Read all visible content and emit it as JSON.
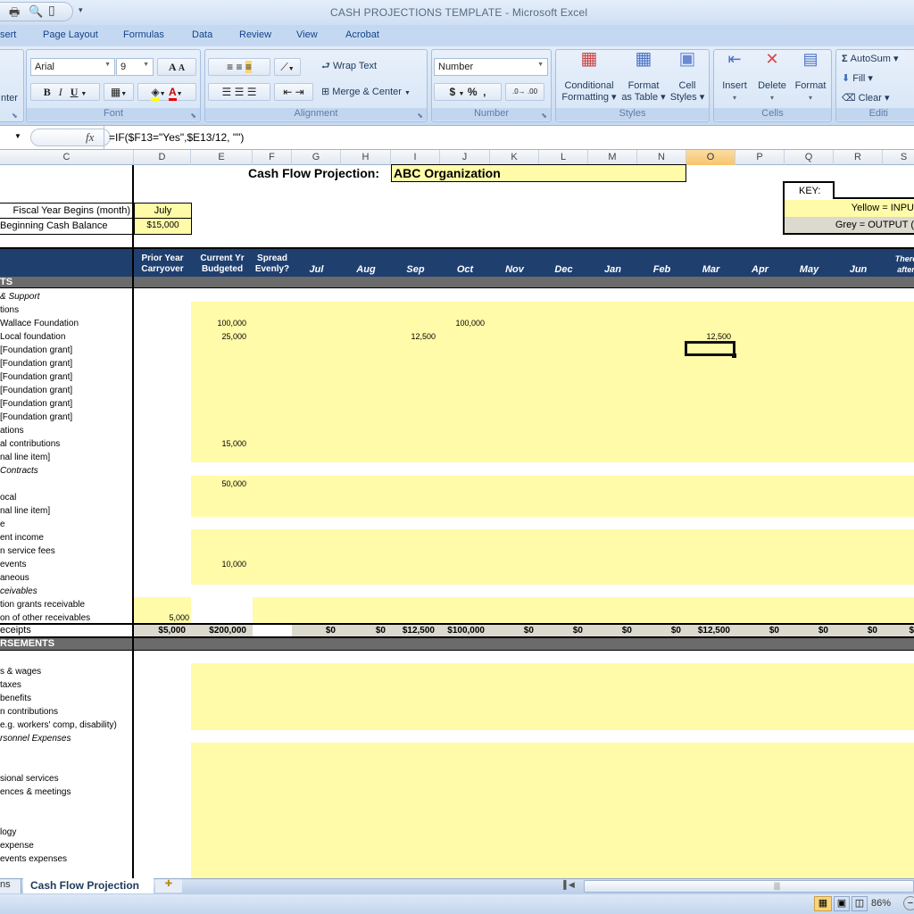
{
  "window": {
    "title": "CASH PROJECTIONS TEMPLATE - Microsoft Excel"
  },
  "quick_access": {
    "icons": [
      "print-icon",
      "print-preview-icon",
      "new-document-icon",
      "customize-dropdown-icon"
    ],
    "dropdown": "▾"
  },
  "ribbon_tabs": [
    "sert",
    "Page Layout",
    "Formulas",
    "Data",
    "Review",
    "View",
    "Acrobat"
  ],
  "ribbon": {
    "clipboard_partial": "nter",
    "font": {
      "name": "Arial",
      "size": "9",
      "label": "Font",
      "bold": "B",
      "italic": "I",
      "underline": "U",
      "grow": "A",
      "shrink": "A",
      "fontcolor": "A"
    },
    "alignment": {
      "label": "Alignment",
      "wrap_text": "Wrap Text",
      "merge_center": "Merge & Center"
    },
    "number": {
      "format": "Number",
      "label": "Number",
      "currency": "$",
      "percent": "%",
      "comma": ",",
      "inc_decimal": "←.0 .00",
      "dec_decimal": ".00 →.0"
    },
    "styles": {
      "label": "Styles",
      "conditional": [
        "Conditional",
        "Formatting"
      ],
      "format_table": [
        "Format",
        "as Table"
      ],
      "cell_styles": [
        "Cell",
        "Styles"
      ]
    },
    "cells": {
      "label": "Cells",
      "insert": "Insert",
      "delete": "Delete",
      "format": "Format"
    },
    "editing": {
      "label": "Editi",
      "autosum": "AutoSum",
      "fill": "Fill",
      "clear": "Clear"
    }
  },
  "formula_bar": {
    "fx": "fx",
    "formula": "=IF($F13=\"Yes\",$E13/12, \"\")"
  },
  "columns": [
    "C",
    "D",
    "E",
    "F",
    "G",
    "H",
    "I",
    "J",
    "K",
    "L",
    "M",
    "N",
    "O",
    "P",
    "Q",
    "R",
    "S"
  ],
  "selected_column": "O",
  "sheet": {
    "title_label": "Cash Flow Projection:",
    "org_name": "ABC Organization",
    "fiscal_label": "Fiscal Year Begins (month)",
    "fiscal_value": "July",
    "cash_label": "Beginning Cash Balance",
    "cash_value": "$15,000",
    "key": {
      "title": "KEY:",
      "yellow": "Yellow = INPU",
      "grey": "Grey = OUTPUT ("
    },
    "headers": {
      "prior": [
        "Prior Year",
        "Carryover"
      ],
      "current": [
        "Current Yr",
        "Budgeted"
      ],
      "spread": [
        "Spread",
        "Evenly?"
      ],
      "months": [
        "Jul",
        "Aug",
        "Sep",
        "Oct",
        "Nov",
        "Dec",
        "Jan",
        "Feb",
        "Mar",
        "Apr",
        "May",
        "Jun"
      ],
      "thereafter": [
        "There",
        "after"
      ]
    },
    "section_receipts": "TS",
    "section_disbursements": "RSEMENTS",
    "receipt_rows": [
      {
        "label": "& Support",
        "italic": true
      },
      {
        "label": "tions"
      },
      {
        "label": "Wallace Foundation",
        "budget": "100,000",
        "oct": "100,000"
      },
      {
        "label": "Local foundation",
        "budget": "25,000",
        "sep": "12,500",
        "mar": "12,500"
      },
      {
        "label": "[Foundation grant]"
      },
      {
        "label": "[Foundation grant]"
      },
      {
        "label": "[Foundation grant]"
      },
      {
        "label": "[Foundation grant]"
      },
      {
        "label": "[Foundation grant]"
      },
      {
        "label": "[Foundation grant]"
      },
      {
        "label": "ations"
      },
      {
        "label": "al contributions",
        "budget": "15,000"
      },
      {
        "label": "nal line item]"
      },
      {
        "label": "Contracts",
        "italic": true
      },
      {
        "label": "",
        "budget": "50,000"
      },
      {
        "label": "ocal"
      },
      {
        "label": "nal line item]"
      },
      {
        "label": "e"
      },
      {
        "label": "ent income"
      },
      {
        "label": "n service fees"
      },
      {
        "label": "events",
        "budget": "10,000"
      },
      {
        "label": "aneous"
      },
      {
        "label": "ceivables",
        "italic": true
      },
      {
        "label": "tion grants receivable"
      },
      {
        "label": "on of other receivables",
        "prior": "5,000"
      }
    ],
    "totals": {
      "label": "eceipts",
      "prior": "$5,000",
      "budget": "$200,000",
      "months": [
        "$0",
        "$0",
        "$12,500",
        "$100,000",
        "$0",
        "$0",
        "$0",
        "$0",
        "$12,500",
        "$0",
        "$0",
        "$0"
      ],
      "thereafter": "$"
    },
    "disb_rows": [
      {
        "label": ""
      },
      {
        "label": "s & wages"
      },
      {
        "label": "taxes"
      },
      {
        "label": " benefits"
      },
      {
        "label": "n contributions"
      },
      {
        "label": "e.g. workers' comp, disability)"
      },
      {
        "label": "rsonnel Expenses",
        "italic": true
      },
      {
        "label": ""
      },
      {
        "label": ""
      },
      {
        "label": "sional services"
      },
      {
        "label": "ences & meetings"
      },
      {
        "label": ""
      },
      {
        "label": ""
      },
      {
        "label": "logy"
      },
      {
        "label": " expense"
      },
      {
        "label": " events expenses"
      }
    ]
  },
  "sheet_tabs": {
    "prev": "ns",
    "active": "Cash Flow Projection",
    "insert_icon": "insert-sheet-icon"
  },
  "status": {
    "zoom": "86%"
  }
}
